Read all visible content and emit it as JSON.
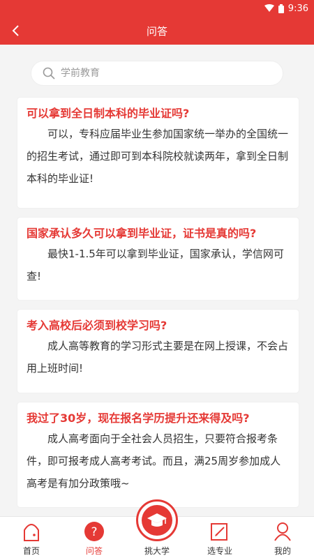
{
  "status_bar": {
    "time": "9:36"
  },
  "header": {
    "title": "问答"
  },
  "search": {
    "placeholder": "学前教育"
  },
  "cards": [
    {
      "question": "可以拿到全日制本科的毕业证吗?",
      "answer": "可以，专科应届毕业生参加国家统一举办的全国统一的招生考试，通过即可到本科院校就读两年，拿到全日制本科的毕业证!"
    },
    {
      "question": "国家承认多久可以拿到毕业证，证书是真的吗?",
      "answer": "最快1-1.5年可以拿到毕业证，国家承认，学信网可查!"
    },
    {
      "question": "考入高校后必须到校学习吗?",
      "answer": "成人高等教育的学习形式主要是在网上授课，不会占用上班时间!"
    },
    {
      "question": "我过了30岁，现在报名学历提升还来得及吗?",
      "answer": "成人高考面向于全社会人员招生，只要符合报考条件，即可报考成人高考考试。而且，满25周岁参加成人高考是有加分政策哦~"
    }
  ],
  "tabbar": {
    "items": [
      {
        "label": "首页",
        "icon": "home-icon"
      },
      {
        "label": "问答",
        "icon": "question-icon"
      },
      {
        "label": "挑大学",
        "icon": "graduation-cap-icon"
      },
      {
        "label": "选专业",
        "icon": "edit-icon"
      },
      {
        "label": "我的",
        "icon": "user-icon"
      }
    ],
    "active_index": 1
  },
  "colors": {
    "primary": "#e53935",
    "text": "#333333",
    "background": "#f4f4f4"
  }
}
